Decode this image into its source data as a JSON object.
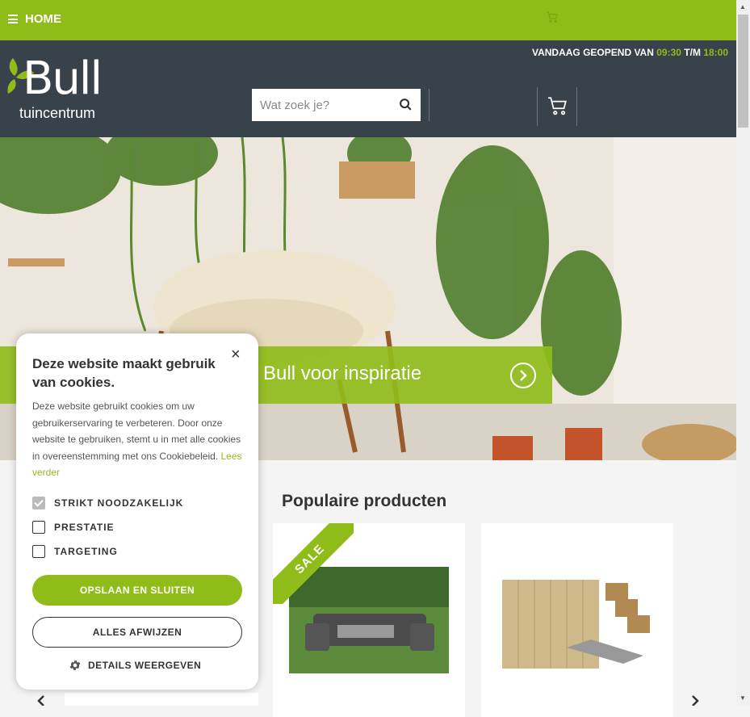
{
  "topbar": {
    "menu_label": "HOME",
    "menu_icon": "hamburger-icon",
    "cart_icon": "cart-icon"
  },
  "header": {
    "hours": {
      "prefix": "VANDAAG GEOPEND VAN",
      "open": "09:30",
      "sep": "T/M",
      "close": "18:00"
    },
    "logo": {
      "word": "Bull",
      "sub": "tuincentrum"
    },
    "search": {
      "placeholder": "Wat zoek je?",
      "icon": "search-icon"
    },
    "cart_icon": "cart-icon"
  },
  "hero": {
    "banner_text": "Bull voor inspiratie",
    "arrow_icon": "chevron-right-circle-icon"
  },
  "products": {
    "title": "Populaire producten",
    "items": [
      {
        "badge": "SALE"
      },
      {
        "badge": ""
      }
    ]
  },
  "cookie": {
    "title": "Deze website maakt gebruik van cookies.",
    "body": "Deze website gebruikt cookies om uw gebruikerservaring te verbeteren. Door onze website te gebruiken, stemt u in met alle cookies in overeenstemming met ons Cookiebeleid.",
    "link": "Lees verder",
    "options": [
      {
        "label": "STRIKT NOODZAKELIJK",
        "checked": true
      },
      {
        "label": "PRESTATIE",
        "checked": false
      },
      {
        "label": "TARGETING",
        "checked": false
      }
    ],
    "save_label": "OPSLAAN EN SLUITEN",
    "reject_label": "ALLES AFWIJZEN",
    "details_label": "DETAILS WEERGEVEN",
    "close_symbol": "×"
  },
  "colors": {
    "brand_green": "#8fbc19",
    "header_dark": "#37424b"
  }
}
